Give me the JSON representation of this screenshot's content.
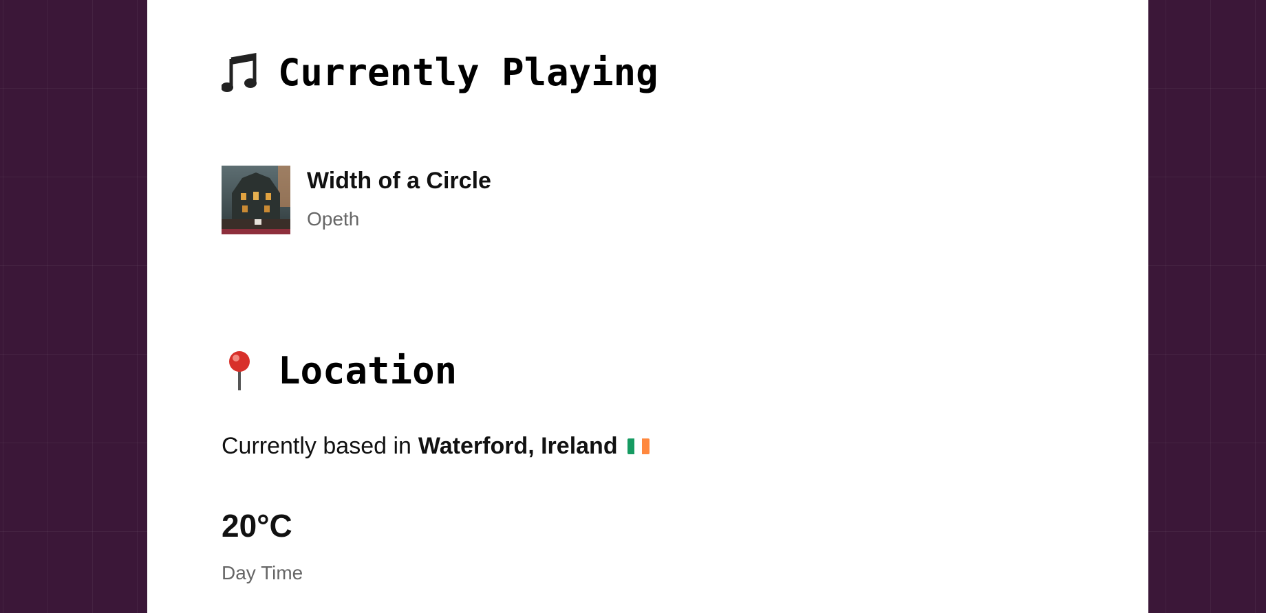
{
  "currently_playing": {
    "heading": "Currently Playing",
    "heading_icon": "musical-notes-icon",
    "track": {
      "title": "Width of a Circle",
      "artist": "Opeth",
      "album_art": "album-art-haunted-mansion"
    }
  },
  "location": {
    "heading": "Location",
    "heading_icon": "round-pushpin-icon",
    "based_prefix": "Currently based in",
    "place": "Waterford, Ireland",
    "flag_icon": "ireland-flag-icon",
    "temperature": "20°C",
    "time_of_day": "Day Time"
  },
  "colors": {
    "background": "#3b1738",
    "panel": "#ffffff",
    "secondary_text": "#666666",
    "flag": [
      "#169b62",
      "#ffffff",
      "#ff883e"
    ]
  }
}
